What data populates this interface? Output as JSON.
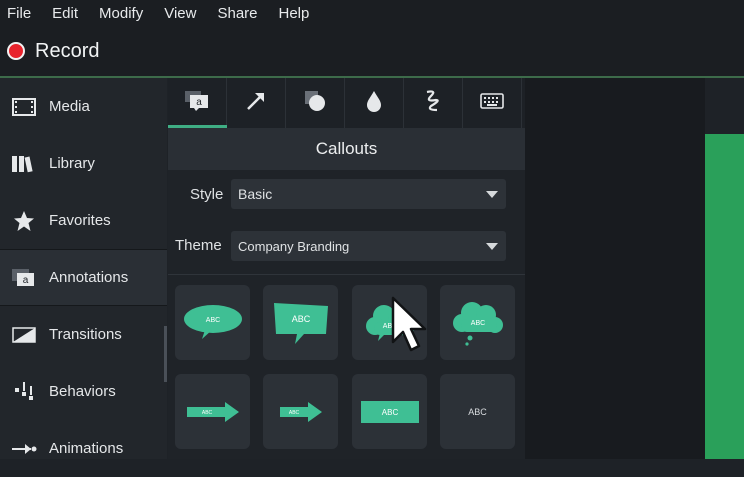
{
  "menu": {
    "items": [
      "File",
      "Edit",
      "Modify",
      "View",
      "Share",
      "Help"
    ]
  },
  "record": {
    "label": "Record"
  },
  "sidebar": {
    "items": [
      {
        "label": "Media",
        "icon": "film-icon"
      },
      {
        "label": "Library",
        "icon": "books-icon"
      },
      {
        "label": "Favorites",
        "icon": "star-icon"
      },
      {
        "label": "Annotations",
        "icon": "annotation-icon"
      },
      {
        "label": "Transitions",
        "icon": "transition-icon"
      },
      {
        "label": "Behaviors",
        "icon": "behaviors-icon"
      },
      {
        "label": "Animations",
        "icon": "animations-icon"
      }
    ],
    "active": "Annotations"
  },
  "panel": {
    "tabs": [
      {
        "icon": "callout-icon",
        "active": true
      },
      {
        "icon": "arrow-icon"
      },
      {
        "icon": "shape-icon"
      },
      {
        "icon": "blur-drop-icon"
      },
      {
        "icon": "sketch-icon"
      },
      {
        "icon": "keyboard-icon"
      }
    ],
    "title": "Callouts",
    "style": {
      "label": "Style",
      "value": "Basic"
    },
    "theme": {
      "label": "Theme",
      "value": "Company Branding"
    },
    "callouts": [
      {
        "type": "speech-bubble-oval",
        "text": "ABC"
      },
      {
        "type": "speech-bubble-rect",
        "text": "ABC"
      },
      {
        "type": "thought-cloud",
        "text": "ABC"
      },
      {
        "type": "thought-cloud-dots",
        "text": "ABC"
      },
      {
        "type": "arrow-long",
        "text": "ABC"
      },
      {
        "type": "arrow-short",
        "text": "ABC"
      },
      {
        "type": "rectangle",
        "text": "ABC"
      },
      {
        "type": "text-only",
        "text": "ABC"
      }
    ]
  },
  "colors": {
    "accent": "#3fae84",
    "record": "#e8232c",
    "canvas": "#2aa05a"
  }
}
